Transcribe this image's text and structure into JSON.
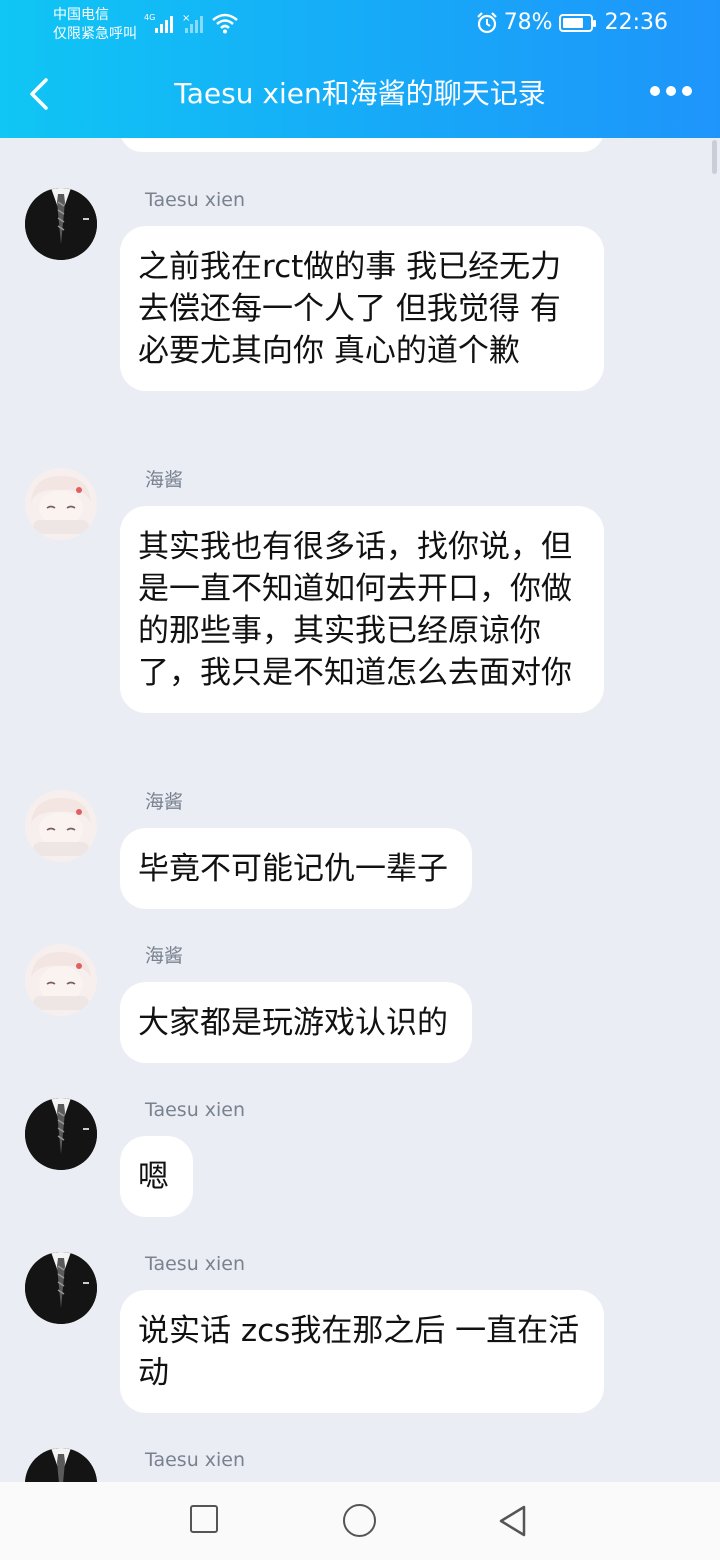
{
  "status_bar": {
    "carrier_line1": "中国电信",
    "carrier_line2": "仅限紧急呼叫",
    "network": "4G",
    "battery": "78%",
    "battery_level": 0.78,
    "time": "22:36"
  },
  "header": {
    "title": "Taesu xien和海酱的聊天记录",
    "back_icon": "chevron-left-icon",
    "more_icon": "more-dots-icon"
  },
  "messages": [
    {
      "sender": "Taesu xien",
      "avatar": "suit-avatar",
      "text": "之前我在rct做的事 我已经无力去偿还每一个人了 但我觉得 有必要尤其向你 真心的道个歉"
    },
    {
      "sender": "海酱",
      "avatar": "anime-avatar",
      "text": "其实我也有很多话，找你说，但是一直不知道如何去开口，你做的那些事，其实我已经原谅你了，我只是不知道怎么去面对你"
    },
    {
      "sender": "海酱",
      "avatar": "anime-avatar",
      "text": "毕竟不可能记仇一辈子"
    },
    {
      "sender": "海酱",
      "avatar": "anime-avatar",
      "text": "大家都是玩游戏认识的"
    },
    {
      "sender": "Taesu xien",
      "avatar": "suit-avatar",
      "text": "嗯"
    },
    {
      "sender": "Taesu xien",
      "avatar": "suit-avatar",
      "text": "说实话 zcs我在那之后 一直在活动"
    },
    {
      "sender": "Taesu xien",
      "avatar": "suit-avatar",
      "text": ""
    }
  ],
  "navbar": {
    "recent_icon": "square-icon",
    "home_icon": "circle-icon",
    "back_icon": "triangle-back-icon"
  }
}
